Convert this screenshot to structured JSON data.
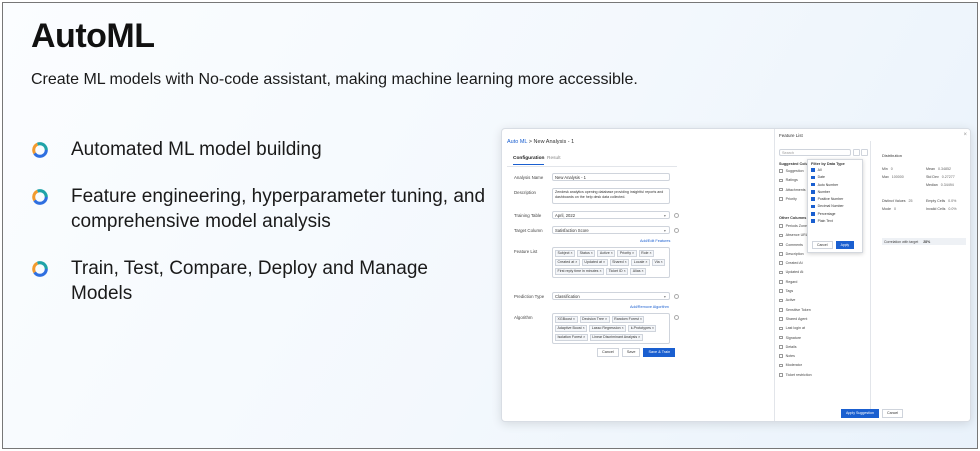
{
  "hero": {
    "title": "AutoML",
    "subtitle": "Create ML models with No-code assistant, making machine learning more accessible."
  },
  "bullets": [
    {
      "text": "Automated ML model building",
      "icon": "ring-icon"
    },
    {
      "text": "Feature engineering, hyperparameter tuning, and comprehensive  model analysis",
      "icon": "ring-icon"
    },
    {
      "text": "Train, Test, Compare, Deploy and Manage Models",
      "icon": "ring-icon"
    }
  ],
  "colors": {
    "ring_blue": "#2f6fe0",
    "ring_orange": "#f29a2e",
    "ring_teal": "#1fa3a8",
    "accent": "#1a5fd0"
  },
  "mock": {
    "breadcrumb_root": "Auto ML",
    "breadcrumb_current": " > New Analysis - 1",
    "tabs": [
      "Configuration",
      "Result"
    ],
    "form": {
      "analysis_name_label": "Analysis Name",
      "analysis_name_value": "New Analysis - 1",
      "description_label": "Description",
      "description_value": "Zendesk analytics opening database providing insightful reports and dashboards on the help desk data collected.",
      "training_table_label": "Training Table",
      "training_table_value": "April, 2022",
      "target_column_label": "Target Column",
      "target_column_value": "Satisfaction Score",
      "add_edit_features": "Add/Edit Features",
      "feature_list_label": "Feature List",
      "features": [
        "Subject",
        "Status",
        "Active",
        "Priority",
        "Role",
        "Created at",
        "Updated at",
        "Shared",
        "Locale",
        "Via",
        "First reply time in minutes",
        "Ticket ID",
        "Alias"
      ],
      "prediction_type_label": "Prediction Type",
      "prediction_type_value": "Classification",
      "add_remove_algorithm": "Add/Remove Algorithm",
      "algorithm_label": "Algorithm",
      "algorithms": [
        "XGBoost",
        "Decision Tree",
        "Random Forest",
        "Adaptive Boost",
        "Lasso Regression",
        "k-Prototypes",
        "Isolation Forest",
        "Linear Discriminant Analysis"
      ],
      "cancel": "Cancel",
      "save": "Save",
      "save_train": "Save & Train"
    },
    "panel": {
      "title": "Feature List",
      "close": "×",
      "search_placeholder": "Search",
      "suggested_heading": "Suggested Columns",
      "suggested": [
        "Suggestion",
        "Ratings",
        "Attachments",
        "Priority"
      ],
      "other_heading": "Other Columns",
      "other": [
        "Periods Zone",
        "Absence URL",
        "Comments",
        "Description",
        "Created At",
        "Updated At",
        "Regard",
        "Tags",
        "Active",
        "Sensitive Token",
        "Shared Agent",
        "Last login at",
        "Signature",
        "Details",
        "Notes",
        "Moderator",
        "Ticket restriction"
      ],
      "filter": {
        "title": "Filter by Data Type",
        "items": [
          "All",
          "Date",
          "Auto Number",
          "Number",
          "Positive Number",
          "Decimal Number",
          "Percentage",
          "Plain Text"
        ],
        "cancel": "Cancel",
        "apply": "Apply"
      },
      "dist": {
        "title": "Distribution",
        "stats": [
          {
            "label": "Min",
            "value": "0"
          },
          {
            "label": "Mean",
            "value": "0.34852"
          },
          {
            "label": "Max",
            "value": "100000"
          },
          {
            "label": "Std Dev",
            "value": "0.27277"
          },
          {
            "label": "Median",
            "value": "0.34494"
          },
          {
            "label": "Distinct Values",
            "value": "25"
          },
          {
            "label": "Empty Cells",
            "value": "0.0%"
          },
          {
            "label": "Mode",
            "value": "0"
          },
          {
            "label": "Invalid Cells",
            "value": "0.0%"
          }
        ],
        "correlation_label": "Correlation with target",
        "correlation_value": "28%"
      },
      "apply_suggestions": "Apply Suggestion",
      "cancel": "Cancel"
    }
  }
}
